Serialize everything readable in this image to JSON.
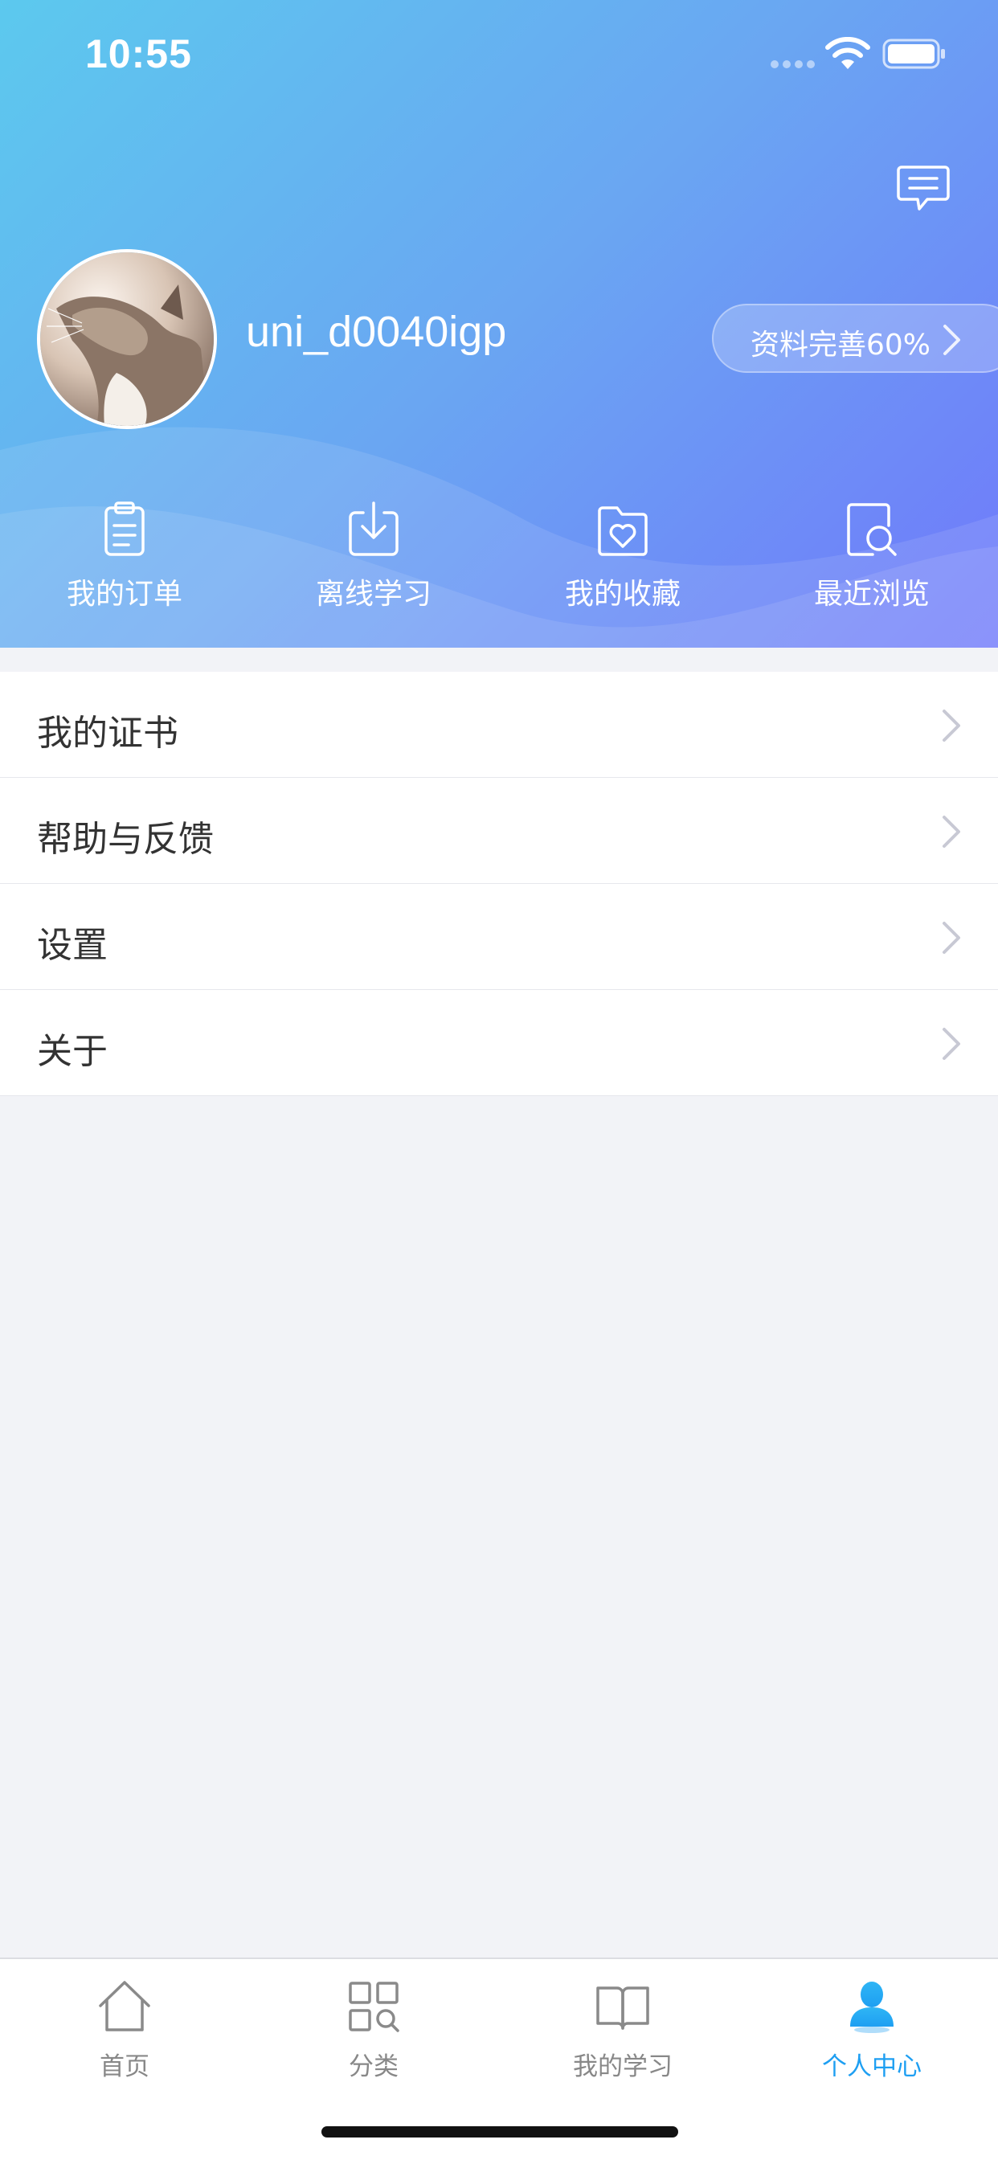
{
  "status_bar": {
    "time": "10:55"
  },
  "profile": {
    "username": "uni_d0040igp",
    "completion_label": "资料完善60%"
  },
  "quick_actions": [
    {
      "label": "我的订单",
      "icon": "clipboard-icon"
    },
    {
      "label": "离线学习",
      "icon": "download-icon"
    },
    {
      "label": "我的收藏",
      "icon": "heart-folder-icon"
    },
    {
      "label": "最近浏览",
      "icon": "search-history-icon"
    }
  ],
  "menu": [
    {
      "label": "我的证书"
    },
    {
      "label": "帮助与反馈"
    },
    {
      "label": "设置"
    },
    {
      "label": "关于"
    }
  ],
  "tabbar": [
    {
      "label": "首页",
      "icon": "home-icon",
      "active": false
    },
    {
      "label": "分类",
      "icon": "category-icon",
      "active": false
    },
    {
      "label": "我的学习",
      "icon": "book-icon",
      "active": false
    },
    {
      "label": "个人中心",
      "icon": "person-icon",
      "active": true
    }
  ],
  "colors": {
    "gradient_start": "#5cc9ee",
    "gradient_end": "#7079fb",
    "active_tab": "#1e9ff2",
    "page_background": "#f2f3f7"
  }
}
